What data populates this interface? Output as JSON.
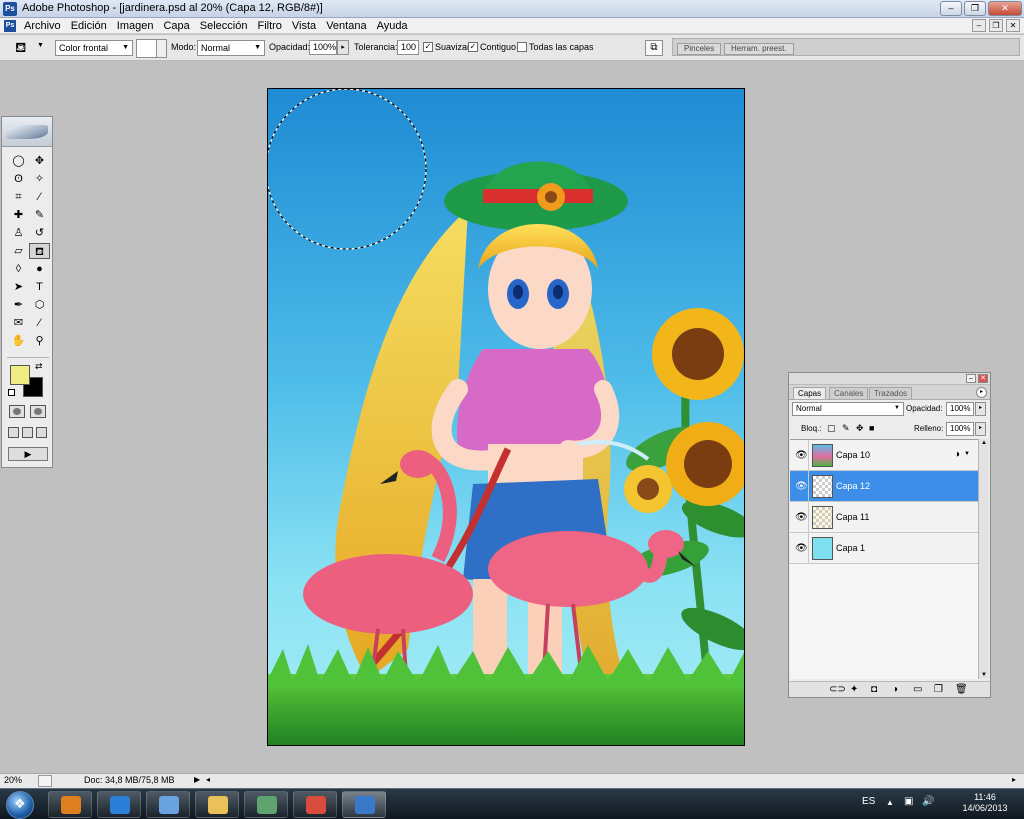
{
  "window": {
    "title": "Adobe Photoshop - [jardinera.psd al 20% (Capa 12, RGB/8#)]",
    "logo_text": "Ps",
    "minimize_glyph": "–",
    "maximize_glyph": "❐",
    "close_glyph": "✕"
  },
  "menu": {
    "items": [
      "Archivo",
      "Edición",
      "Imagen",
      "Capa",
      "Selección",
      "Filtro",
      "Vista",
      "Ventana",
      "Ayuda"
    ],
    "doc_minimize": "–",
    "doc_restore": "❐",
    "doc_close": "✕"
  },
  "options": {
    "tool_icon": "paint-bucket-icon",
    "tool_glyph": "⛾",
    "fill_source": "Color frontal",
    "mode_label": "Modo:",
    "mode_value": "Normal",
    "opacity_label": "Opacidad:",
    "opacity_value": "100%",
    "tolerance_label": "Tolerancia:",
    "tolerance_value": "100",
    "antialias_label": "Suavizar",
    "antialias_checked": true,
    "contiguous_label": "Contiguo",
    "contiguous_checked": true,
    "all_layers_label": "Todas las capas",
    "all_layers_checked": false,
    "check_glyph": "✓",
    "palette_well_tabs": [
      "Pinceles",
      "Herram. preest."
    ]
  },
  "toolbox": {
    "tools": [
      {
        "name": "elliptical-marquee-icon",
        "glyph": "◯"
      },
      {
        "name": "move-icon",
        "glyph": "✥"
      },
      {
        "name": "lasso-icon",
        "glyph": "ʘ"
      },
      {
        "name": "magic-wand-icon",
        "glyph": "✧"
      },
      {
        "name": "crop-icon",
        "glyph": "⌗"
      },
      {
        "name": "slice-icon",
        "glyph": "⁄"
      },
      {
        "name": "healing-brush-icon",
        "glyph": "✚"
      },
      {
        "name": "brush-icon",
        "glyph": "✎"
      },
      {
        "name": "clone-stamp-icon",
        "glyph": "♙"
      },
      {
        "name": "history-brush-icon",
        "glyph": "↺"
      },
      {
        "name": "eraser-icon",
        "glyph": "▱"
      },
      {
        "name": "paint-bucket-icon",
        "glyph": "⛾",
        "active": true
      },
      {
        "name": "blur-icon",
        "glyph": "◊"
      },
      {
        "name": "dodge-icon",
        "glyph": "●"
      },
      {
        "name": "path-selection-icon",
        "glyph": "➤"
      },
      {
        "name": "type-icon",
        "glyph": "T"
      },
      {
        "name": "pen-icon",
        "glyph": "✒"
      },
      {
        "name": "shape-icon",
        "glyph": "⬡"
      },
      {
        "name": "notes-icon",
        "glyph": "✉"
      },
      {
        "name": "eyedropper-icon",
        "glyph": "⁄"
      },
      {
        "name": "hand-icon",
        "glyph": "✋"
      },
      {
        "name": "zoom-icon",
        "glyph": "⚲"
      }
    ],
    "foreground_color": "#f0ec84",
    "background_color": "#000000",
    "swap_glyph": "⇄",
    "jump_glyph": "▶"
  },
  "layers_panel": {
    "tabs": [
      "Capas",
      "Canales",
      "Trazados"
    ],
    "active_tab": "Capas",
    "menu_glyph": "▸",
    "blend_mode": "Normal",
    "opacity_label": "Opacidad:",
    "opacity_value": "100%",
    "lock_label": "Bloq.:",
    "fill_label": "Relleno:",
    "fill_value": "100%",
    "eye_glyph": "👁",
    "layers": [
      {
        "name": "Capa 10",
        "visible": true,
        "selected": false,
        "has_effects": true,
        "thumb": "art"
      },
      {
        "name": "Capa 12",
        "visible": true,
        "selected": true,
        "has_effects": false,
        "thumb": "transparent"
      },
      {
        "name": "Capa 11",
        "visible": true,
        "selected": false,
        "has_effects": false,
        "thumb": "light"
      },
      {
        "name": "Capa 1",
        "visible": true,
        "selected": false,
        "has_effects": false,
        "thumb": "#7fe0f0"
      }
    ],
    "effect_glyph": "◑",
    "more_glyph": "▼",
    "bottom_icons": [
      "link-icon",
      "fx-icon",
      "mask-icon",
      "adjustment-icon",
      "folder-icon",
      "new-layer-icon",
      "trash-icon"
    ],
    "bottom_glyphs": [
      "⊂⊃",
      "✦",
      "◘",
      "◑",
      "▭",
      "❐",
      "🗑"
    ]
  },
  "status": {
    "zoom": "20%",
    "doc": "Doc: 34,8 MB/75,8 MB",
    "play_glyph": "▶",
    "left_arrow": "◂",
    "right_arrow": "▸"
  },
  "taskbar": {
    "apps": [
      {
        "name": "media-player-icon",
        "color": "#e07f1f",
        "active": false
      },
      {
        "name": "internet-explorer-icon",
        "color": "#2c7fd8",
        "active": false
      },
      {
        "name": "paint-icon",
        "color": "#6aa3e0",
        "active": false
      },
      {
        "name": "file-explorer-icon",
        "color": "#e9c05a",
        "active": false
      },
      {
        "name": "network-icon",
        "color": "#5fa36f",
        "active": false
      },
      {
        "name": "chrome-icon",
        "color": "#d94c3d",
        "active": false
      },
      {
        "name": "photoshop-icon",
        "color": "#3a78c9",
        "active": true
      }
    ],
    "language": "ES",
    "show_hidden_glyph": "▲",
    "network_glyph": "▣",
    "volume_glyph": "🔊",
    "time": "11:46",
    "date": "14/06/2013"
  }
}
